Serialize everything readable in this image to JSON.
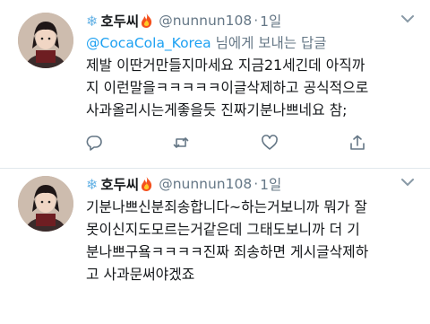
{
  "tweets": [
    {
      "display_name": "호두씨",
      "handle": "@nunnun108",
      "separator": "·",
      "time": "1일",
      "reply_to_account": "@CocaCola_Korea",
      "reply_to_suffix": " 님에게 보내는 답글",
      "text_lines": [
        "제발 이딴거만들지마세요 지금21세긴데 아직까",
        "지 이런말을ㅋㅋㅋㅋㅋ이글삭제하고 공식적으로",
        "사과올리시는게좋을듯 진짜기분나쁘네요 참;"
      ]
    },
    {
      "display_name": "호두씨",
      "handle": "@nunnun108",
      "separator": "·",
      "time": "1일",
      "text_lines": [
        "기분나쁘신분죄송합니다~하는거보니까 뭐가 잘",
        "못이신지도모르는거같은데 그태도보니까 더 기",
        "분나쁘구욬ㅋㅋㅋㅋ진짜 죄송하면 게시글삭제하",
        "고 사과문써야겠죠"
      ]
    }
  ],
  "icons": {
    "name_prefix": "snowflake-icon",
    "name_suffix": "fire-icon",
    "actions": [
      "reply-icon",
      "retweet-icon",
      "like-icon",
      "share-icon"
    ],
    "menu": "chevron-down-icon"
  },
  "colors": {
    "text": "#14171a",
    "secondary": "#657786",
    "link": "#1da1f2",
    "snowflake": "#69b4e6"
  }
}
